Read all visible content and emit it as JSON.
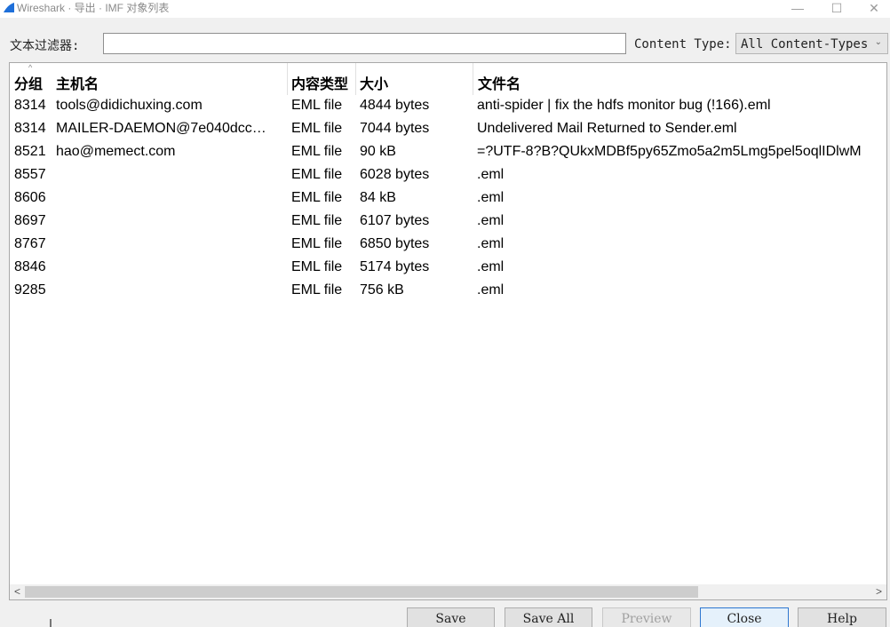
{
  "window": {
    "title": "Wireshark · 导出 · IMF 对象列表",
    "controls": {
      "minimize": "—",
      "maximize": "☐",
      "close": "✕"
    },
    "icon": "wireshark-fin-icon",
    "accent_color": "#1e6fd9"
  },
  "filter": {
    "label": "文本过滤器:",
    "value": "",
    "placeholder": ""
  },
  "content_type": {
    "label": "Content Type:",
    "selected": "All Content-Types",
    "chevron": "⌄"
  },
  "table": {
    "sort_indicator": "^",
    "columns": [
      "分组",
      "主机名",
      "内容类型",
      "大小",
      "文件名"
    ],
    "rows": [
      {
        "group": "8314",
        "host": "tools@didichuxing.com",
        "ctype": "EML file",
        "size": "4844 bytes",
        "file": "anti-spider | fix the hdfs monitor bug (!166).eml"
      },
      {
        "group": "8314",
        "host": "MAILER-DAEMON@7e040dcc…",
        "ctype": "EML file",
        "size": "7044 bytes",
        "file": "Undelivered Mail Returned to Sender.eml"
      },
      {
        "group": "8521",
        "host": "hao@memect.com",
        "ctype": "EML file",
        "size": "90 kB",
        "file": "=?UTF-8?B?QUkxMDBf5py65Zmo5a2m5Lmg5pel5oqlIDlwM"
      },
      {
        "group": "8557",
        "host": "",
        "ctype": "EML file",
        "size": "6028 bytes",
        "file": ".eml"
      },
      {
        "group": "8606",
        "host": "",
        "ctype": "EML file",
        "size": "84 kB",
        "file": ".eml"
      },
      {
        "group": "8697",
        "host": "",
        "ctype": "EML file",
        "size": "6107 bytes",
        "file": ".eml"
      },
      {
        "group": "8767",
        "host": "",
        "ctype": "EML file",
        "size": "6850 bytes",
        "file": ".eml"
      },
      {
        "group": "8846",
        "host": "",
        "ctype": "EML file",
        "size": "5174 bytes",
        "file": ".eml"
      },
      {
        "group": "9285",
        "host": "",
        "ctype": "EML file",
        "size": "756 kB",
        "file": ".eml"
      }
    ]
  },
  "scrollbar": {
    "left_arrow": "<",
    "right_arrow": ">"
  },
  "buttons": {
    "save": "Save",
    "save_all": "Save All",
    "preview": "Preview",
    "close": "Close",
    "help": "Help"
  }
}
